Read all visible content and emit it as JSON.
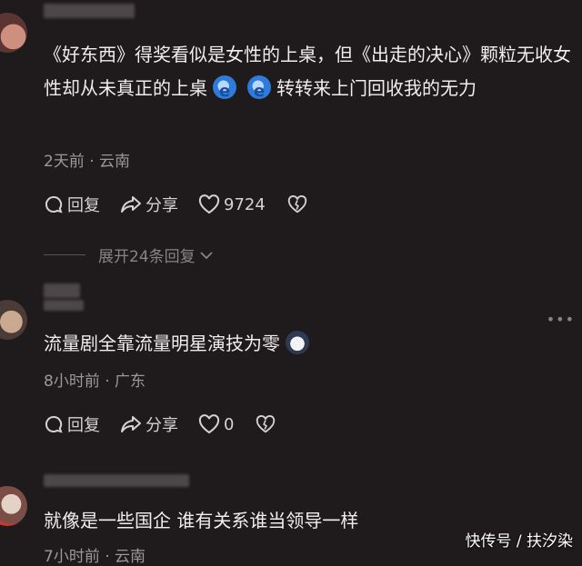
{
  "comments": [
    {
      "text_part1": "《好东西》得奖看似是女性的上桌，但《出走的决心》颗粒无收女性却从未真正的上桌",
      "text_part2": "转转来上门回收我的无力",
      "emoji_icons": [
        "ie-icon",
        "ie-icon"
      ],
      "meta": "2天前 · 云南",
      "reply_label": "回复",
      "share_label": "分享",
      "like_count": "9724",
      "expand_label": "展开24条回复"
    },
    {
      "text": "流量剧全靠流量明星演技为零",
      "emoji_icons": [
        "cat-icon"
      ],
      "meta": "8小时前 · 广东",
      "reply_label": "回复",
      "share_label": "分享",
      "like_count": "0"
    },
    {
      "text": "就像是一些国企 谁有关系谁当领导一样",
      "meta": "7小时前 · 云南"
    }
  ],
  "watermark": "快传号 / 扶汐染"
}
